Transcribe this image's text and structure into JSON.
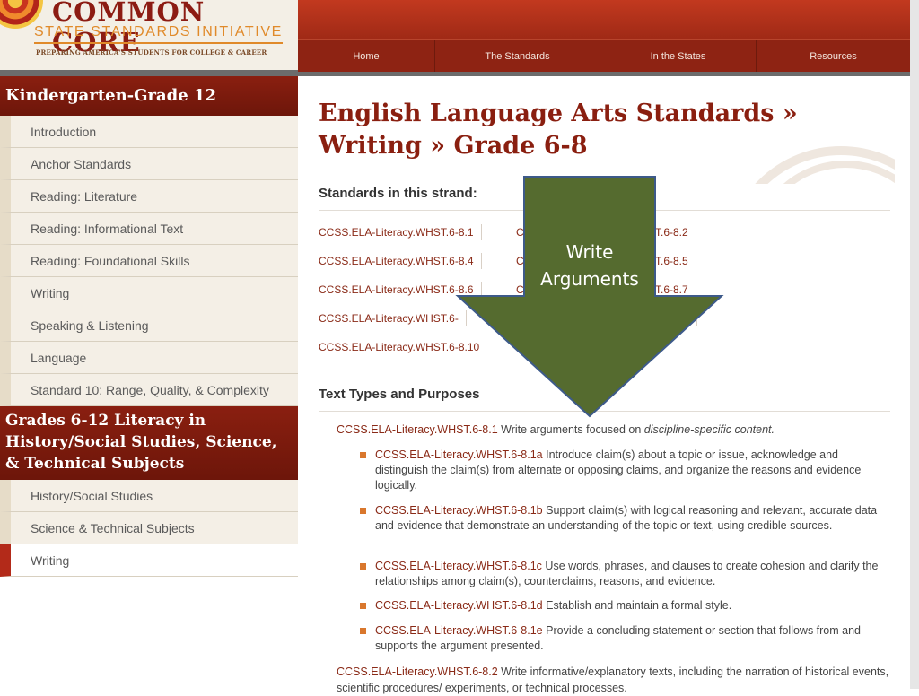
{
  "header": {
    "logo_title": "COMMON CORE",
    "logo_subtitle": "STATE STANDARDS INITIATIVE",
    "logo_tagline": "PREPARING AMERICA'S STUDENTS FOR COLLEGE & CAREER"
  },
  "nav": {
    "items": [
      "Home",
      "The Standards",
      "In the States",
      "Resources"
    ]
  },
  "sidebar": {
    "heading1": "Kindergarten-Grade 12",
    "items1": [
      "Introduction",
      "Anchor Standards",
      "Reading: Literature",
      "Reading: Informational Text",
      "Reading: Foundational Skills",
      "Writing",
      "Speaking & Listening",
      "Language",
      "Standard 10: Range, Quality, & Complexity"
    ],
    "heading2": "Grades 6-12 Literacy in History/Social Studies, Science, & Technical Subjects",
    "items2": [
      "History/Social Studies",
      "Science & Technical Subjects",
      "Writing"
    ]
  },
  "main": {
    "title": "English Language Arts Standards » Writing » Grade 6-8",
    "strand_heading": "Standards in this strand:",
    "strand_links": {
      "c1": [
        "CCSS.ELA-Literacy.WHST.6-8.1",
        "CCSS.ELA-Literacy.WHST.6-8.4",
        "CCSS.ELA-Literacy.WHST.6-8.6",
        "CCSS.ELA-Literacy.WHST.6-",
        "CCSS.ELA-Literacy.WHST.6-8.10"
      ],
      "c2": [
        "C",
        "C",
        "C"
      ],
      "c3": [
        "T.6-8.2",
        "T.6-8.5",
        "T.6-8.7"
      ]
    },
    "text_types_heading": "Text Types and Purposes",
    "std1_code": "CCSS.ELA-Literacy.WHST.6-8.1",
    "std1_text": "Write arguments focused on",
    "std1_em": "discipline-specific content.",
    "substandards": [
      {
        "code": "CCSS.ELA-Literacy.WHST.6-8.1a",
        "text": "Introduce claim(s) about a topic or issue, acknowledge and distinguish the claim(s) from alternate or opposing claims, and organize the reasons and evidence logically."
      },
      {
        "code": "CCSS.ELA-Literacy.WHST.6-8.1b",
        "text": "Support claim(s) with logical reasoning and relevant, accurate data and evidence that demonstrate an understanding of the topic or text, using credible sources."
      },
      {
        "code": "CCSS.ELA-Literacy.WHST.6-8.1c",
        "text": "Use words, phrases, and clauses to create cohesion and clarify the relationships among claim(s), counterclaims, reasons, and evidence."
      },
      {
        "code": "CCSS.ELA-Literacy.WHST.6-8.1d",
        "text": "Establish and maintain a formal style."
      },
      {
        "code": "CCSS.ELA-Literacy.WHST.6-8.1e",
        "text": "Provide a concluding statement or section that follows from and supports the argument presented."
      }
    ],
    "std2_code": "CCSS.ELA-Literacy.WHST.6-8.2",
    "std2_text": "Write informative/explanatory texts, including the narration of historical events, scientific procedures/ experiments, or technical processes."
  },
  "overlay": {
    "line1": "Write",
    "line2": "Arguments",
    "color": "#556b2f",
    "border": "#3d5a8a"
  }
}
